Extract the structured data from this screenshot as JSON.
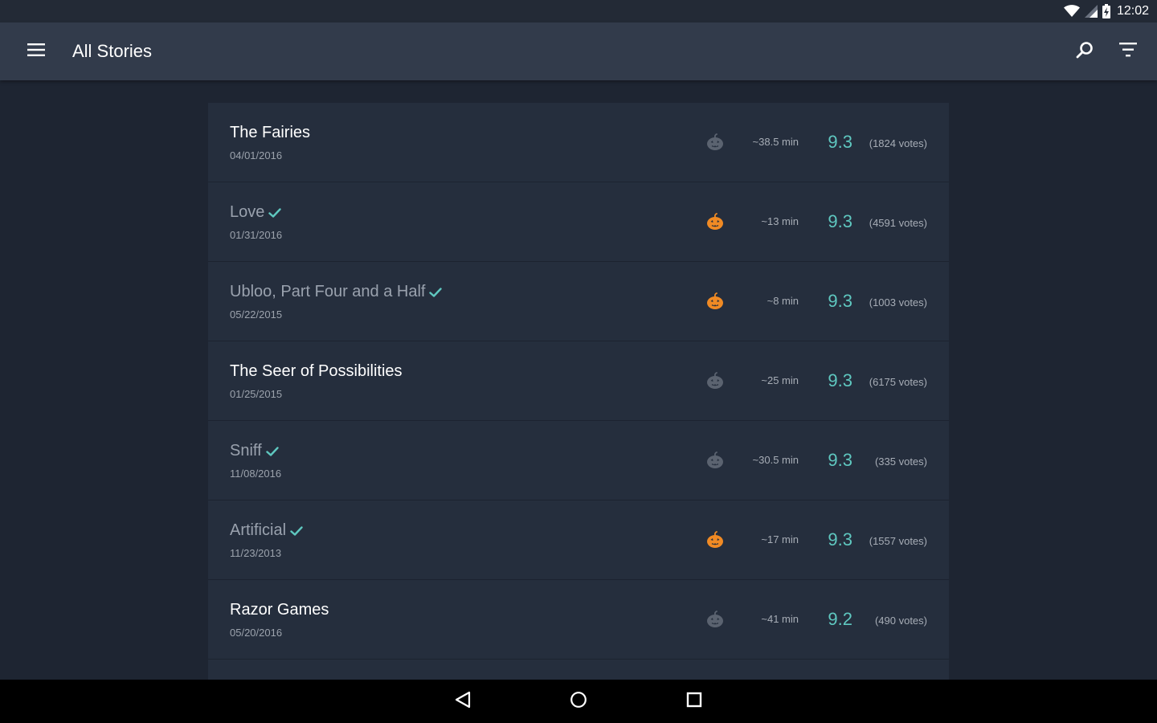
{
  "status": {
    "time": "12:02"
  },
  "app_bar": {
    "title": "All Stories"
  },
  "colors": {
    "accent": "#5fc8c0",
    "pumpkin_active": "#f08a24",
    "pumpkin_inactive": "#5b6370",
    "check": "#5fc8c0"
  },
  "stories": [
    {
      "title": "The Fairies",
      "date": "04/01/2016",
      "duration": "~38.5 min",
      "score": "9.3",
      "votes": "(1824 votes)",
      "read": false,
      "pumpkin": "inactive"
    },
    {
      "title": "Love",
      "date": "01/31/2016",
      "duration": "~13 min",
      "score": "9.3",
      "votes": "(4591 votes)",
      "read": true,
      "pumpkin": "active"
    },
    {
      "title": "Ubloo, Part Four and a Half",
      "date": "05/22/2015",
      "duration": "~8 min",
      "score": "9.3",
      "votes": "(1003 votes)",
      "read": true,
      "pumpkin": "active"
    },
    {
      "title": "The Seer of Possibilities",
      "date": "01/25/2015",
      "duration": "~25 min",
      "score": "9.3",
      "votes": "(6175 votes)",
      "read": false,
      "pumpkin": "inactive"
    },
    {
      "title": "Sniff",
      "date": "11/08/2016",
      "duration": "~30.5 min",
      "score": "9.3",
      "votes": "(335 votes)",
      "read": true,
      "pumpkin": "inactive"
    },
    {
      "title": "Artificial",
      "date": "11/23/2013",
      "duration": "~17 min",
      "score": "9.3",
      "votes": "(1557 votes)",
      "read": true,
      "pumpkin": "active"
    },
    {
      "title": "Razor Games",
      "date": "05/20/2016",
      "duration": "~41 min",
      "score": "9.2",
      "votes": "(490 votes)",
      "read": false,
      "pumpkin": "inactive"
    }
  ]
}
